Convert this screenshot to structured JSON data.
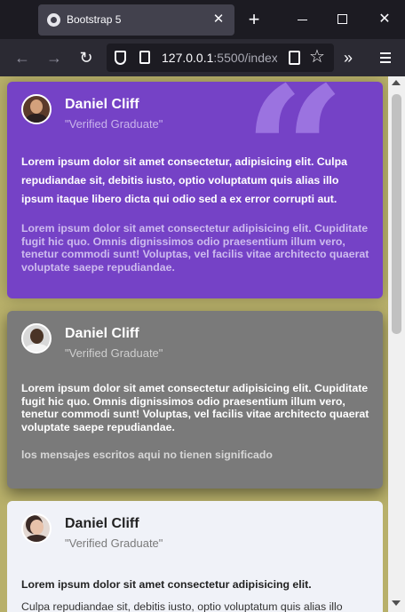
{
  "browser": {
    "tab_title": "Bootstrap 5",
    "tab_close": "✕",
    "new_tab": "+",
    "url_host": "127.0.0.1",
    "url_rest": ":5500/index.",
    "icons": [
      "favicon-icon",
      "close-icon",
      "plus-icon",
      "minimize-icon",
      "maximize-icon",
      "window-close-icon",
      "back-icon",
      "forward-icon",
      "reload-icon",
      "shield-icon",
      "page-icon",
      "reader-icon",
      "star-icon",
      "overflow-icon",
      "menu-icon"
    ]
  },
  "page": {
    "background_color": "#b8b06a",
    "quote_mark": "“",
    "cards": [
      {
        "name": "Daniel Cliff",
        "role": "\"Verified Graduate\"",
        "bold_text": "Lorem ipsum dolor sit amet consectetur, adipisicing elit. Culpa repudiandae sit, debitis iusto, optio voluptatum quis alias illo ipsum itaque libero dicta qui odio sed a ex error corrupti aut.",
        "light_text": "Lorem ipsum dolor sit amet consectetur adipisicing elit. Cupiditate fugit hic quo. Omnis dignissimos odio praesentium illum vero, tenetur commodi sunt! Voluptas, vel facilis vitae architecto quaerat voluptate saepe repudiandae.",
        "color": "#7542c6"
      },
      {
        "name": "Daniel Cliff",
        "role": "\"Verified Graduate\"",
        "bold_text": "Lorem ipsum dolor sit amet consectetur adipisicing elit. Cupiditate fugit hic quo. Omnis dignissimos odio praesentium illum vero, tenetur commodi sunt! Voluptas, vel facilis vitae architecto quaerat voluptate saepe repudiandae.",
        "light_text": "los mensajes escritos aqui no tienen significado",
        "color": "#7a7a7a"
      },
      {
        "name": "Daniel Cliff",
        "role": "\"Verified Graduate\"",
        "bold_text": "Lorem ipsum dolor sit amet consectetur adipisicing elit.",
        "light_text": "Culpa repudiandae sit, debitis iusto, optio voluptatum quis alias illo",
        "color": "#f0f2f8"
      }
    ]
  }
}
